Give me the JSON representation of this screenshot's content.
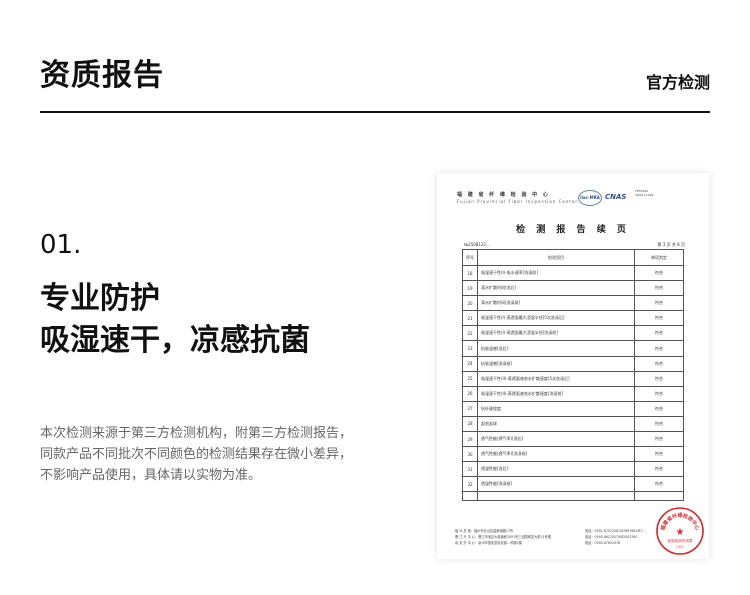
{
  "header": {
    "title": "资质报告",
    "tag": "官方检测"
  },
  "section": {
    "number": "01.",
    "headline_lines": [
      "专业防护",
      "吸湿速干，凉感抗菌"
    ],
    "description_lines": [
      "本次检测来源于第三方检测机构，附第三方检测报告，",
      "同款产品不同批次不同颜色的检测结果存在微小差异，",
      "不影响产品使用，具体请以实物为准。"
    ]
  },
  "report": {
    "org_name": "福 建 省 纤 维 检 验 中 心",
    "org_name_en": "Fujian Provincial Fiber Inspection Center",
    "logo_ilac": "ilac-MRA",
    "logo_cnas": "CNAS",
    "logo_testing_lines": [
      "TESTING",
      "CNAS L1064"
    ],
    "title": "检 测 报 告 续 页",
    "report_no": "№2508122…",
    "page_info": "第 3 页 共 8 页",
    "columns": [
      "序号",
      "检验项目",
      "单项判定"
    ],
    "rows": [
      {
        "no": "18",
        "item": "吸湿速干性(I)-吸水速率[洗涤前]",
        "result": "符合"
      },
      {
        "no": "19",
        "item": "滴水扩散时间[洗后]",
        "result": "符合"
      },
      {
        "no": "20",
        "item": "滴水扩散时间[洗涤前]",
        "result": "符合"
      },
      {
        "no": "21",
        "item": "吸湿速干性(I)-蒸透面最大浸湿半径[5次洗涤后]",
        "result": "符合"
      },
      {
        "no": "22",
        "item": "吸湿速干性(I)-蒸透面最大浸湿半径[洗涤前]",
        "result": "符合"
      },
      {
        "no": "23",
        "item": "抗吸湿感[洗后]",
        "result": "符合"
      },
      {
        "no": "24",
        "item": "抗吸湿感[洗涤前]",
        "result": "符合"
      },
      {
        "no": "25",
        "item": "吸湿速干性(II)-蒸透面液态水扩散速度[5次洗涤后]",
        "result": "符合"
      },
      {
        "no": "26",
        "item": "吸湿速干性(II)-蒸透面液态水扩散速度[洗涤前]",
        "result": "符合"
      },
      {
        "no": "27",
        "item": "抗纤维程度",
        "result": "符合"
      },
      {
        "no": "28",
        "item": "起毛起球",
        "result": "符合"
      },
      {
        "no": "29",
        "item": "透气性能(透气率)[洗后]",
        "result": "符合"
      },
      {
        "no": "30",
        "item": "透气性能(透气率)[洗涤前]",
        "result": "符合"
      },
      {
        "no": "31",
        "item": "透湿性能[洗后]",
        "result": "符合"
      },
      {
        "no": "32",
        "item": "透湿性能[洗涤前]",
        "result": "符合"
      }
    ],
    "footer_left": [
      "福 州 总 部：福州市仓山区建新南路17号",
      "晋 江 分 中 心：晋江市池店大道南段3001号三创园研发大厦11号楼",
      "泉 安 分 中 心：泉州市惠安县崇武镇…号楼2楼"
    ],
    "footer_right": [
      "电话：0591-87572081/87887663/87…",
      "电话：0595-86125079/82002760",
      "电话：0595-87852978"
    ],
    "seal_text": "福建省纤维检验中心",
    "seal_sub": "检验检测专用章",
    "seal_code": "(32)",
    "seal_color": "#d8292f"
  }
}
